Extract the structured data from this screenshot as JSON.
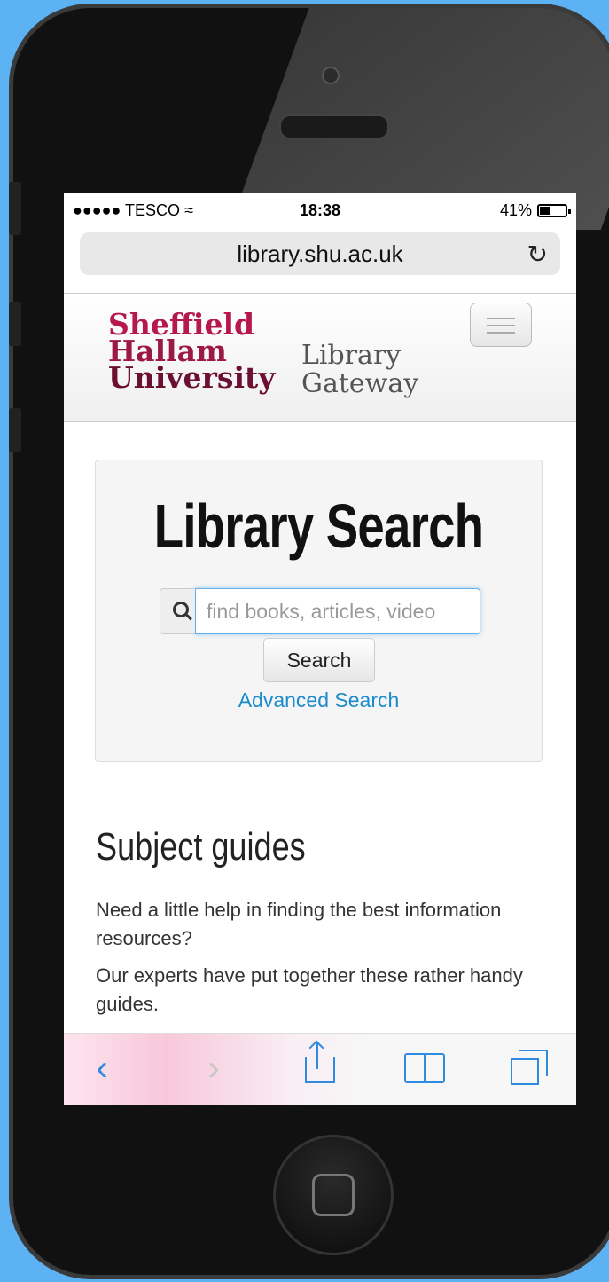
{
  "status_bar": {
    "carrier": "●●●●● TESCO",
    "wifi_icon": "wifi-icon",
    "time": "18:38",
    "battery_percent": "41%",
    "battery_level": 0.41
  },
  "url_bar": {
    "url": "library.shu.ac.uk",
    "reload_icon": "reload-icon"
  },
  "site_header": {
    "logo_line1": "Sheffield",
    "logo_line2": "Hallam",
    "logo_line3": "University",
    "gateway_line1": "Library",
    "gateway_line2": "Gateway",
    "menu_icon": "hamburger-icon"
  },
  "library_search": {
    "title": "Library Search",
    "placeholder": "find books, articles, video",
    "search_button": "Search",
    "advanced_link": "Advanced Search"
  },
  "subject_guides": {
    "title": "Subject guides",
    "paragraph1": "Need a little help in finding the best information resources?",
    "paragraph2": "Our experts have put together these rather handy guides."
  },
  "toolbar": {
    "icons": [
      "back-icon",
      "forward-icon",
      "share-icon",
      "bookmarks-icon",
      "tabs-icon"
    ]
  },
  "colors": {
    "link": "#1a8ccc",
    "ios_blue": "#2f8ae0",
    "brand_red": "#b5174e",
    "background": "#5cb2f2"
  }
}
